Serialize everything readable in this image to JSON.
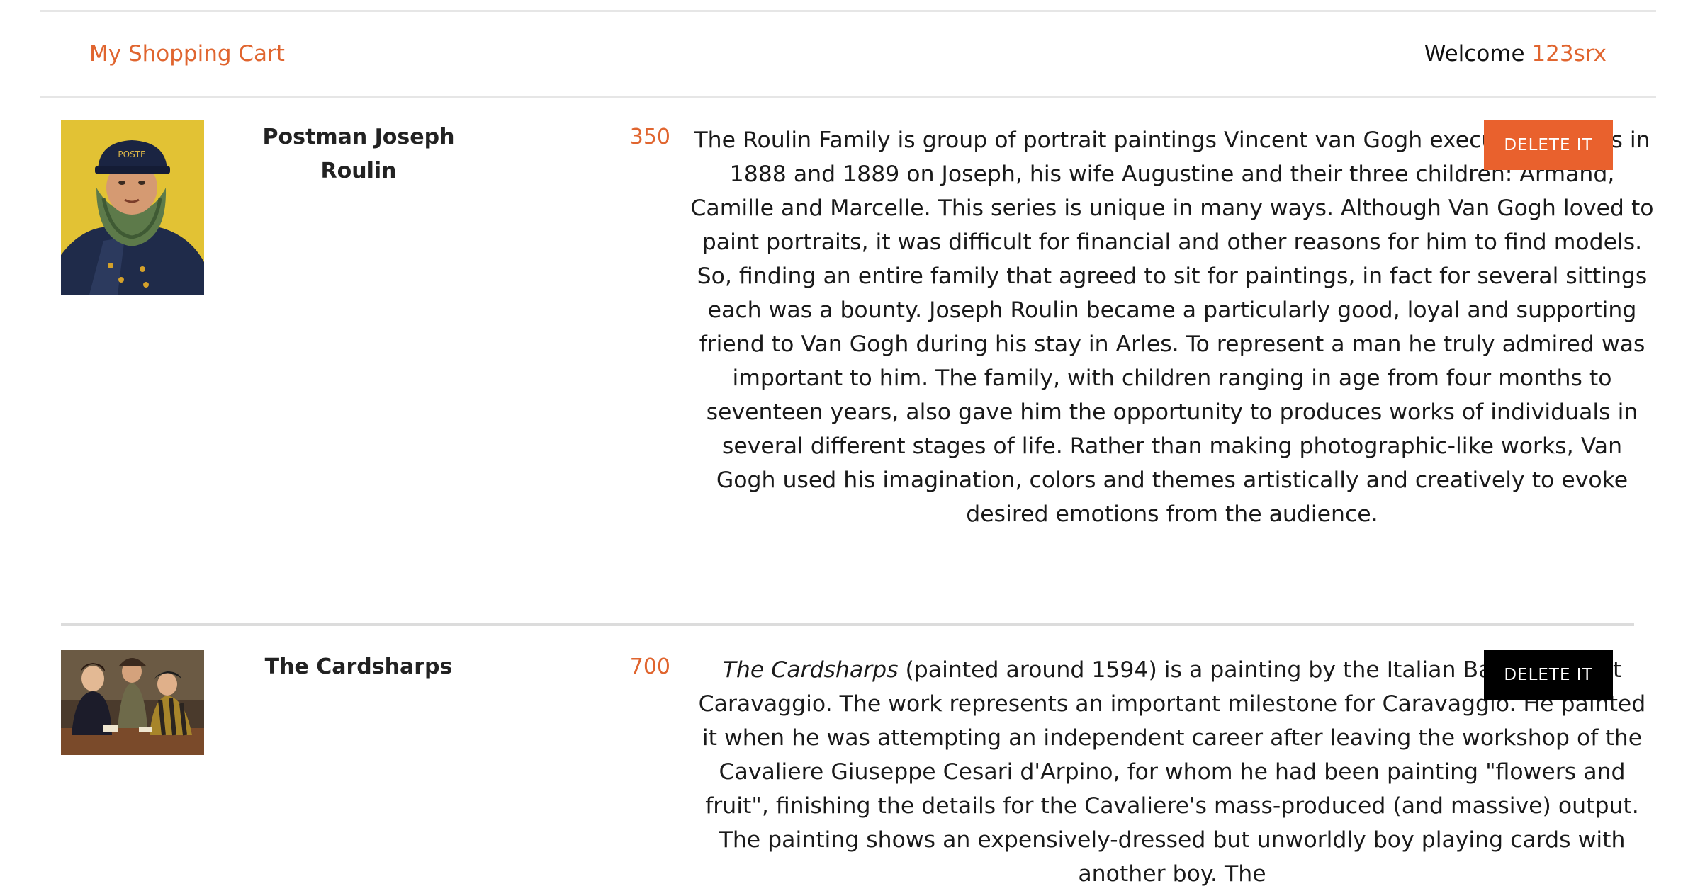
{
  "header": {
    "cart_title": "My Shopping Cart",
    "welcome_prefix": "Welcome ",
    "username": "123srx"
  },
  "colors": {
    "accent": "#e0652f",
    "delete_primary": "#e9612d",
    "delete_secondary": "#000000"
  },
  "cart": {
    "items": [
      {
        "title": "Postman Joseph Roulin",
        "price": "350",
        "description": "The Roulin Family is group of portrait paintings Vincent van Gogh executed in Arles in 1888 and 1889 on Joseph, his wife Augustine and their three children: Armand, Camille and Marcelle. This series is unique in many ways. Although Van Gogh loved to paint portraits, it was difficult for financial and other reasons for him to find models. So, finding an entire family that agreed to sit for paintings, in fact for several sittings each was a bounty. Joseph Roulin became a particularly good, loyal and supporting friend to Van Gogh during his stay in Arles. To represent a man he truly admired was important to him. The family, with children ranging in age from four months to seventeen years, also gave him the opportunity to produces works of individuals in several different stages of life. Rather than making photographic-like works, Van Gogh used his imagination, colors and themes artistically and creatively to evoke desired emotions from the audience.",
        "delete_label": "DELETE IT"
      },
      {
        "title": "The Cardsharps",
        "price": "700",
        "description_italic": "The Cardsharps",
        "description_rest": " (painted around 1594) is a painting by the Italian Baroque artist Caravaggio. The work represents an important milestone for Caravaggio. He painted it when he was attempting an independent career after leaving the workshop of the Cavaliere Giuseppe Cesari d'Arpino, for whom he had been painting \"flowers and fruit\", finishing the details for the Cavaliere's mass-produced (and massive) output. The painting shows an expensively-dressed but unworldly boy playing cards with another boy. The",
        "delete_label": "DELETE IT"
      }
    ]
  }
}
